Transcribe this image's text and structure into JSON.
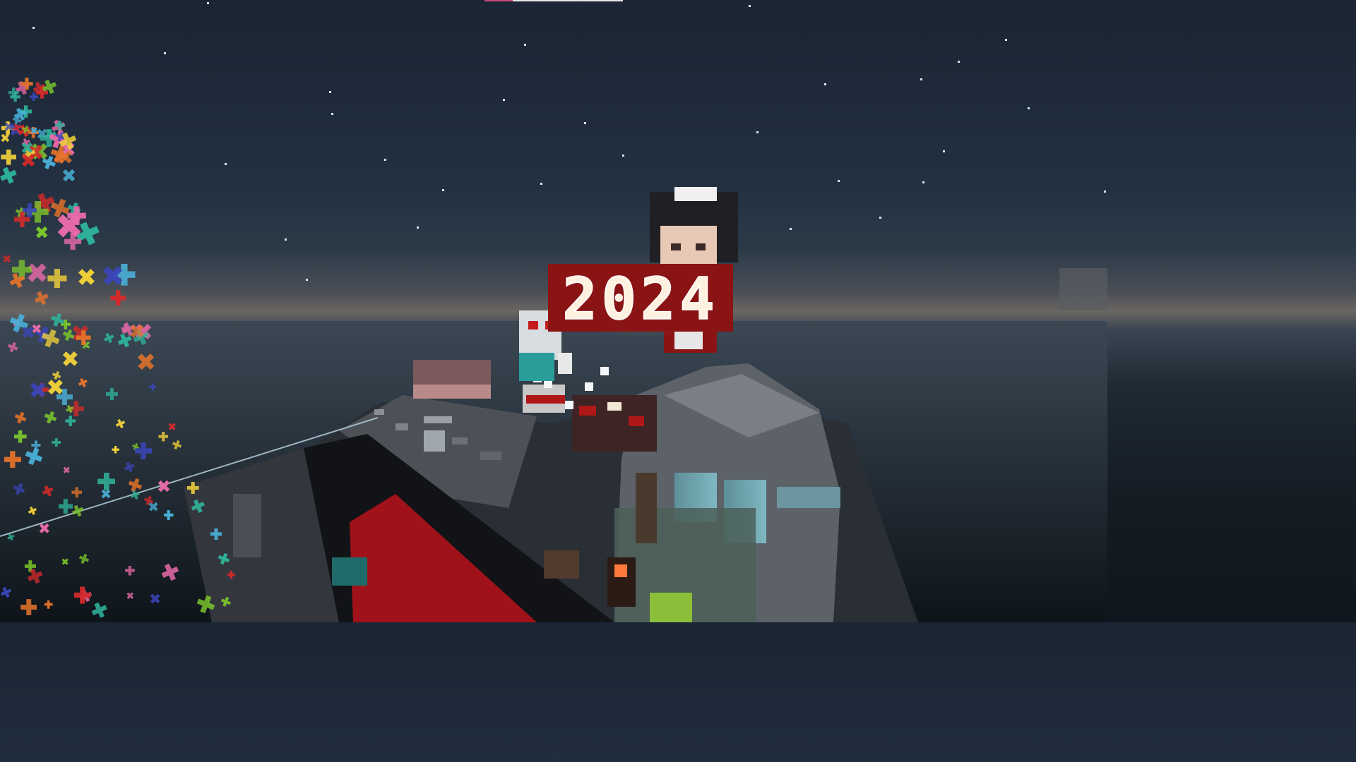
{
  "scene": {
    "type": "voxel-game-screenshot",
    "time_of_day": "night",
    "sky_color_top": "#1b2533",
    "horizon_glow": "#6b6662",
    "sea_color": "#141c24"
  },
  "sign": {
    "text": "2024",
    "background": "#8a1414",
    "bulb_color": "#fff1e0"
  },
  "confetti_colors": [
    "#e8742a",
    "#7cc72c",
    "#3a46b8",
    "#e86aa8",
    "#4ab0d8",
    "#d42a2a",
    "#f2d23a",
    "#2fb39a"
  ],
  "hud": {
    "top_bar_accent": "#c94b7a",
    "top_bar_color": "#e8e8e8"
  }
}
